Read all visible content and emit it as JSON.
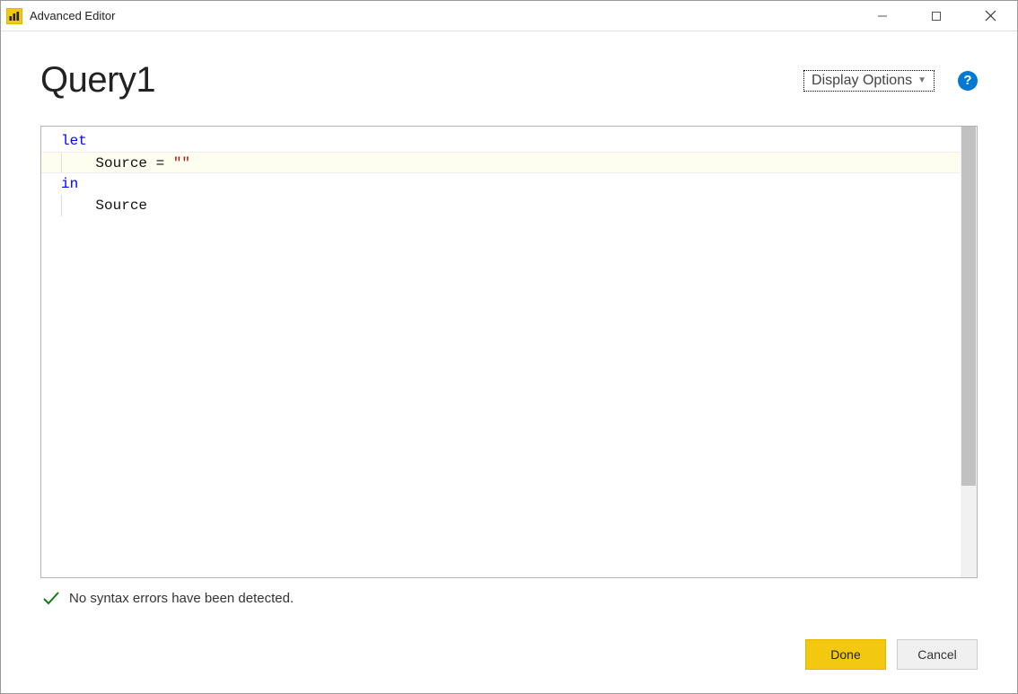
{
  "titlebar": {
    "title": "Advanced Editor"
  },
  "header": {
    "page_title": "Query1",
    "display_options_label": "Display Options"
  },
  "editor": {
    "lines": [
      {
        "tokens": [
          {
            "cls": "kw",
            "text": "let"
          }
        ]
      },
      {
        "tokens": [
          {
            "cls": "plain",
            "text": "    Source = "
          },
          {
            "cls": "str",
            "text": "\"\""
          }
        ],
        "highlight": true,
        "indent": true
      },
      {
        "tokens": [
          {
            "cls": "kw",
            "text": "in"
          }
        ]
      },
      {
        "tokens": [
          {
            "cls": "plain",
            "text": "    Source"
          }
        ],
        "indent": true
      }
    ]
  },
  "status": {
    "message": "No syntax errors have been detected."
  },
  "buttons": {
    "done": "Done",
    "cancel": "Cancel"
  }
}
